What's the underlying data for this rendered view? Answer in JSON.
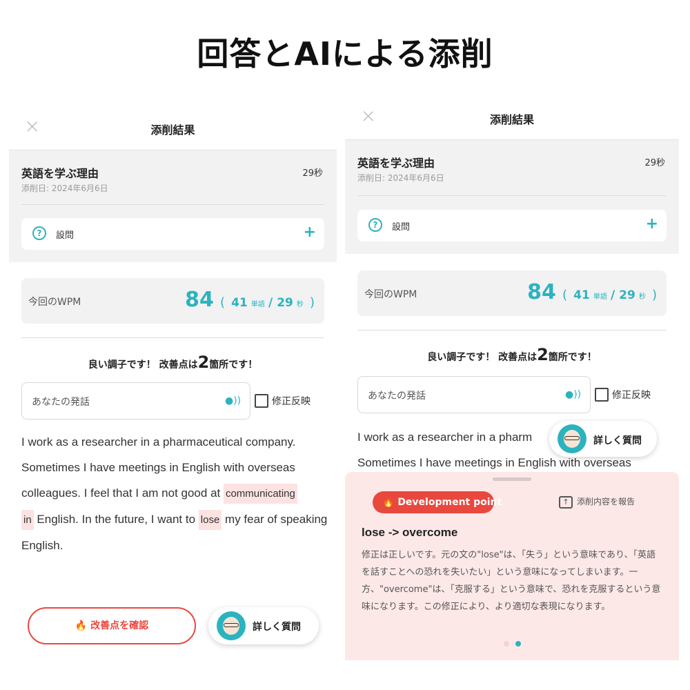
{
  "page_title": "回答とAIによる添削",
  "left": {
    "header_title": "添削結果",
    "topic": "英語を学ぶ理由",
    "seconds": "29秒",
    "date": "添削日: 2024年6月6日",
    "question_label": "設問",
    "wpm_label": "今回のWPM",
    "wpm_value": "84",
    "wpm_open": "(",
    "wpm_words": "41",
    "wpm_words_unit": "単語",
    "wpm_sep": " / ",
    "wpm_secs": "29",
    "wpm_secs_unit": "秒",
    "wpm_close": ")",
    "summary_pre": "良い調子です！ 改善点は",
    "summary_count": "2",
    "summary_post": "箇所です！",
    "speech_label": "あなたの発話",
    "checkbox_label": "修正反映",
    "text_1": "I work as a researcher in a pharmaceutical company. Sometimes I have meetings in English with overseas colleagues. I feel that I am not good at ",
    "hl_1": "communicating",
    "hl_1b": "in",
    "text_2": " English. In the future, I want to ",
    "hl_2": "lose",
    "text_3": " my fear of speaking English.",
    "confirm_button": "改善点を確認",
    "ask_button": "詳しく質問"
  },
  "right": {
    "header_title": "添削結果",
    "topic": "英語を学ぶ理由",
    "seconds": "29秒",
    "date": "添削日: 2024年6月6日",
    "question_label": "設問",
    "wpm_label": "今回のWPM",
    "wpm_value": "84",
    "wpm_open": "(",
    "wpm_words": "41",
    "wpm_words_unit": "単語",
    "wpm_sep": " / ",
    "wpm_secs": "29",
    "wpm_secs_unit": "秒",
    "wpm_close": ")",
    "summary_pre": "良い調子です！ 改善点は",
    "summary_count": "2",
    "summary_post": "箇所です！",
    "speech_label": "あなたの発話",
    "checkbox_label": "修正反映",
    "text_1": "I work as a researcher in a pharm",
    "text_2": "Sometimes I have meetings in English with overseas",
    "ask_button": "詳しく質問",
    "badge": "Development point",
    "report": "添削内容を報告",
    "fix_title": "lose -> overcome",
    "fix_body": "修正は正しいです。元の文の\"lose\"は、「失う」という意味であり、「英語を話すことへの恐れを失いたい」という意味になってしまいます。一方、\"overcome\"は、「克服する」という意味で、恐れを克服するという意味になります。この修正により、より適切な表現になります。"
  },
  "colors": {
    "accent": "#2bb3bf",
    "red": "#e8483e",
    "sheet": "#fde8e8"
  },
  "icons": [
    "close-icon",
    "question-icon",
    "plus-icon",
    "speaker-icon",
    "fire-icon",
    "report-icon",
    "avatar-icon"
  ]
}
